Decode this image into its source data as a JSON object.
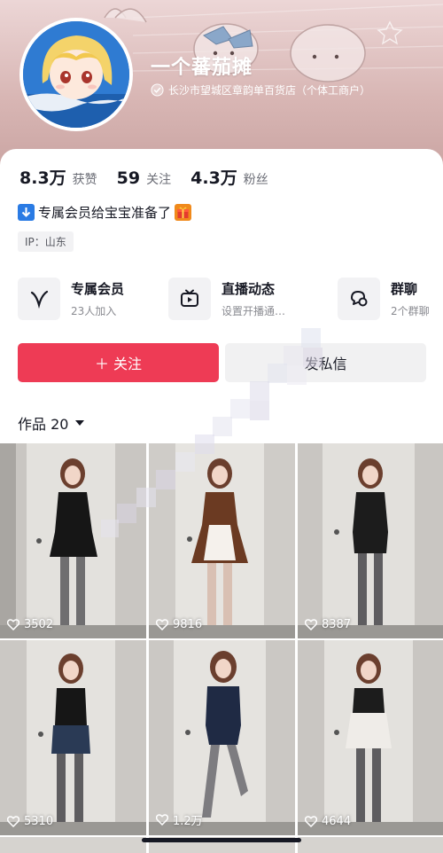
{
  "profile": {
    "nickname": "一个蕃茄摊",
    "store": "长沙市望城区章韵单百货店（个体工商户）"
  },
  "stats": [
    {
      "value": "8.3万",
      "label": "获赞"
    },
    {
      "value": "59",
      "label": "关注"
    },
    {
      "value": "4.3万",
      "label": "粉丝"
    }
  ],
  "bio": {
    "text": "专属会员给宝宝准备了"
  },
  "ip": "IP：山东",
  "features": [
    {
      "title": "专属会员",
      "sub": "23人加入",
      "icon": "v-icon"
    },
    {
      "title": "直播动态",
      "sub": "设置开播通…",
      "icon": "tv-icon"
    },
    {
      "title": "群聊",
      "sub": "2个群聊",
      "icon": "chat-icon"
    }
  ],
  "actions": {
    "follow": "＋ 关注",
    "message": "发私信"
  },
  "works": {
    "label": "作品 20"
  },
  "videos": [
    {
      "likes": "3502"
    },
    {
      "likes": "9816"
    },
    {
      "likes": "8387"
    },
    {
      "likes": "5310"
    },
    {
      "likes": "1.2万"
    },
    {
      "likes": "4644"
    }
  ],
  "colors": {
    "accent": "#ee3b55",
    "header": "#d8b6b4"
  }
}
